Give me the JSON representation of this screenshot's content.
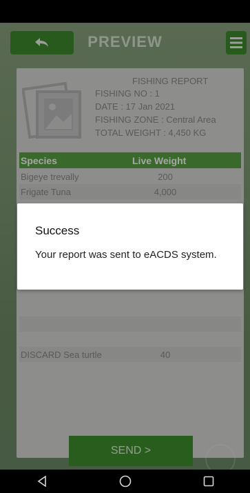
{
  "header": {
    "title": "PREVIEW",
    "back_icon": "back-arrow-icon",
    "menu_icon": "hamburger-menu-icon",
    "accent": "#3d8a2c"
  },
  "report": {
    "title": "FISHING REPORT",
    "fishing_no": "FISHING NO : 1",
    "date": "DATE : 17 Jan 2021",
    "zone": "FISHING ZONE : Central Area",
    "total_weight": "TOTAL WEIGHT : 4,450 KG"
  },
  "table": {
    "col_species": "Species",
    "col_weight": "Live Weight",
    "rows": [
      {
        "species": "Bigeye trevally",
        "weight": "200"
      },
      {
        "species": "Frigate Tuna",
        "weight": "4,000"
      },
      {
        "species": "DISCARD Sea turtle",
        "weight": "40"
      }
    ]
  },
  "send_label": "SEND >",
  "dialog": {
    "title": "Success",
    "message": "Your report was sent to eACDS system."
  },
  "navbar": {
    "back": "nav-back-icon",
    "home": "nav-home-icon",
    "recents": "nav-recents-icon"
  }
}
